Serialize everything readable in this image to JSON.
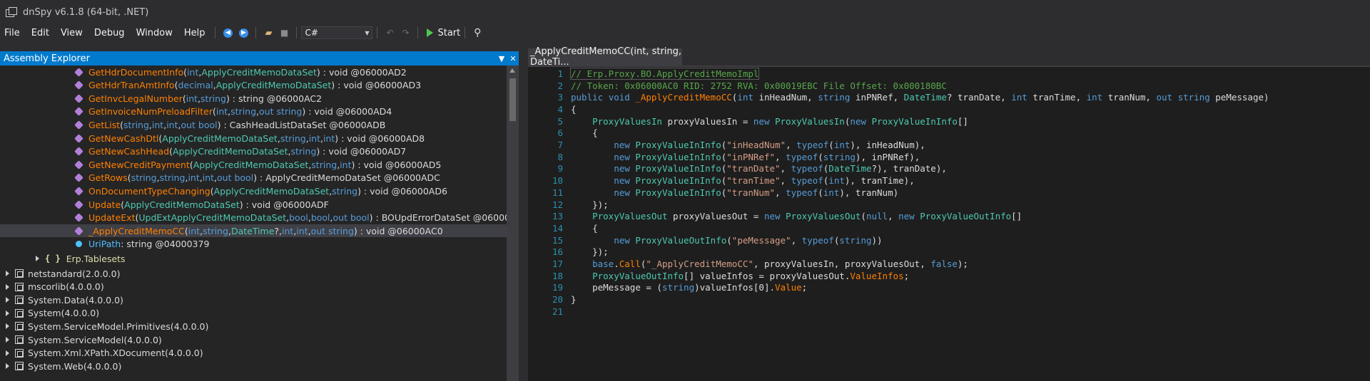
{
  "window": {
    "title": "dnSpy v6.1.8 (64-bit, .NET)"
  },
  "menu": [
    "File",
    "Edit",
    "View",
    "Debug",
    "Window",
    "Help"
  ],
  "toolbar": {
    "language": "C#",
    "start_label": "Start"
  },
  "explorer": {
    "title": "Assembly Explorer",
    "rows": [
      {
        "kind": "method",
        "name": "GetHdrDocumentInfo",
        "params": [
          [
            "int",
            "kw"
          ],
          [
            ", ",
            "plain"
          ],
          [
            "ApplyCreditMemoDataSet",
            "type"
          ]
        ],
        "ret": ") : void @06000AD2"
      },
      {
        "kind": "method",
        "name": "GetHdrTranAmtInfo",
        "params": [
          [
            "decimal",
            "kw"
          ],
          [
            ", ",
            "plain"
          ],
          [
            "ApplyCreditMemoDataSet",
            "type"
          ]
        ],
        "ret": ") : void @06000AD3"
      },
      {
        "kind": "method",
        "name": "GetInvcLegalNumber",
        "params": [
          [
            "int",
            "kw"
          ],
          [
            ", ",
            "plain"
          ],
          [
            "string",
            "kw"
          ]
        ],
        "ret": ") : string @06000AC2"
      },
      {
        "kind": "method",
        "name": "GetInvoiceNumPreloadFilter",
        "params": [
          [
            "int",
            "kw"
          ],
          [
            ", ",
            "plain"
          ],
          [
            "string",
            "kw"
          ],
          [
            ", ",
            "plain"
          ],
          [
            "out string",
            "kw"
          ]
        ],
        "ret": ") : void @06000AD4"
      },
      {
        "kind": "method",
        "name": "GetList",
        "params": [
          [
            "string",
            "kw"
          ],
          [
            ", ",
            "plain"
          ],
          [
            "int",
            "kw"
          ],
          [
            ", ",
            "plain"
          ],
          [
            "int",
            "kw"
          ],
          [
            ", ",
            "plain"
          ],
          [
            "out bool",
            "kw"
          ]
        ],
        "ret": ") : CashHeadListDataSet @06000ADB"
      },
      {
        "kind": "method",
        "name": "GetNewCashDtl",
        "params": [
          [
            "ApplyCreditMemoDataSet",
            "type"
          ],
          [
            ", ",
            "plain"
          ],
          [
            "string",
            "kw"
          ],
          [
            ", ",
            "plain"
          ],
          [
            "int",
            "kw"
          ],
          [
            ", ",
            "plain"
          ],
          [
            "int",
            "kw"
          ]
        ],
        "ret": ") : void @06000AD8"
      },
      {
        "kind": "method",
        "name": "GetNewCashHead",
        "params": [
          [
            "ApplyCreditMemoDataSet",
            "type"
          ],
          [
            ", ",
            "plain"
          ],
          [
            "string",
            "kw"
          ]
        ],
        "ret": ") : void @06000AD7"
      },
      {
        "kind": "method",
        "name": "GetNewCreditPayment",
        "params": [
          [
            "ApplyCreditMemoDataSet",
            "type"
          ],
          [
            ", ",
            "plain"
          ],
          [
            "string",
            "kw"
          ],
          [
            ", ",
            "plain"
          ],
          [
            "int",
            "kw"
          ]
        ],
        "ret": ") : void @06000AD5"
      },
      {
        "kind": "method",
        "name": "GetRows",
        "params": [
          [
            "string",
            "kw"
          ],
          [
            ", ",
            "plain"
          ],
          [
            "string",
            "kw"
          ],
          [
            ", ",
            "plain"
          ],
          [
            "int",
            "kw"
          ],
          [
            ", ",
            "plain"
          ],
          [
            "int",
            "kw"
          ],
          [
            ", ",
            "plain"
          ],
          [
            "out bool",
            "kw"
          ]
        ],
        "ret": ") : ApplyCreditMemoDataSet @06000ADC"
      },
      {
        "kind": "method",
        "name": "OnDocumentTypeChanging",
        "params": [
          [
            "ApplyCreditMemoDataSet",
            "type"
          ],
          [
            ", ",
            "plain"
          ],
          [
            "string",
            "kw"
          ]
        ],
        "ret": ") : void @06000AD6"
      },
      {
        "kind": "method",
        "name": "Update",
        "params": [
          [
            "ApplyCreditMemoDataSet",
            "type"
          ]
        ],
        "ret": ") : void @06000ADF"
      },
      {
        "kind": "method",
        "name": "UpdateExt",
        "params": [
          [
            "UpdExtApplyCreditMemoDataSet",
            "type"
          ],
          [
            ", ",
            "plain"
          ],
          [
            "bool",
            "kw"
          ],
          [
            ", ",
            "plain"
          ],
          [
            "bool",
            "kw"
          ],
          [
            ", ",
            "plain"
          ],
          [
            "out bool",
            "kw"
          ]
        ],
        "ret": ") : BOUpdErrorDataSet @06000A"
      },
      {
        "kind": "method",
        "name": "_ApplyCreditMemoCC",
        "selected": true,
        "params": [
          [
            "int",
            "kw"
          ],
          [
            ", ",
            "plain"
          ],
          [
            "string",
            "kw"
          ],
          [
            ", ",
            "plain"
          ],
          [
            "DateTime",
            "date"
          ],
          [
            "?, ",
            "plain"
          ],
          [
            "int",
            "kw"
          ],
          [
            ", ",
            "plain"
          ],
          [
            "int",
            "kw"
          ],
          [
            ", ",
            "plain"
          ],
          [
            "out string",
            "kw"
          ]
        ],
        "ret": ") : void @06000AC0"
      },
      {
        "kind": "field",
        "name": "UriPath",
        "ret": " : string @04000379"
      }
    ],
    "namespace": "Erp.Tablesets",
    "assemblies": [
      {
        "name": "netstandard",
        "version": "(2.0.0.0)"
      },
      {
        "name": "mscorlib",
        "version": "(4.0.0.0)"
      },
      {
        "name": "System.Data",
        "version": "(4.0.0.0)"
      },
      {
        "name": "System",
        "version": "(4.0.0.0)"
      },
      {
        "name": "System.ServiceModel.Primitives",
        "version": "(4.0.0.0)"
      },
      {
        "name": "System.ServiceModel",
        "version": "(4.0.0.0)"
      },
      {
        "name": "System.Xml.XPath.XDocument",
        "version": "(4.0.0.0)"
      },
      {
        "name": "System.Web",
        "version": "(4.0.0.0)"
      }
    ]
  },
  "editor": {
    "tab_label": "_ApplyCreditMemoCC(int, string, DateTi...",
    "lines": [
      [
        [
          "// Erp.Proxy.BO.ApplyCreditMemoImpl",
          "comment"
        ]
      ],
      [
        [
          "// Token: 0x06000AC0 RID: 2752 RVA: 0x00019EBC File Offset: 0x000180BC",
          "comment"
        ]
      ],
      [
        [
          "public ",
          "kw"
        ],
        [
          "void ",
          "kw"
        ],
        [
          "_ApplyCreditMemoCC",
          "method"
        ],
        [
          "(",
          "plain"
        ],
        [
          "int ",
          "kw"
        ],
        [
          "inHeadNum",
          "param"
        ],
        [
          ", ",
          "plain"
        ],
        [
          "string ",
          "kw"
        ],
        [
          "inPNRef",
          "param"
        ],
        [
          ", ",
          "plain"
        ],
        [
          "DateTime",
          "type"
        ],
        [
          "? ",
          "plain"
        ],
        [
          "tranDate",
          "param"
        ],
        [
          ", ",
          "plain"
        ],
        [
          "int ",
          "kw"
        ],
        [
          "tranTime",
          "param"
        ],
        [
          ", ",
          "plain"
        ],
        [
          "int ",
          "kw"
        ],
        [
          "tranNum",
          "param"
        ],
        [
          ", ",
          "plain"
        ],
        [
          "out ",
          "kw"
        ],
        [
          "string ",
          "kw"
        ],
        [
          "peMessage",
          "param"
        ],
        [
          ")",
          "plain"
        ]
      ],
      [
        [
          "{",
          "plain"
        ]
      ],
      [
        [
          "    ",
          "plain"
        ],
        [
          "ProxyValuesIn ",
          "type"
        ],
        [
          "proxyValuesIn = ",
          "plain"
        ],
        [
          "new ",
          "kw"
        ],
        [
          "ProxyValuesIn",
          "type"
        ],
        [
          "(",
          "plain"
        ],
        [
          "new ",
          "kw"
        ],
        [
          "ProxyValueInInfo",
          "type"
        ],
        [
          "[]",
          "plain"
        ]
      ],
      [
        [
          "    {",
          "plain"
        ]
      ],
      [
        [
          "        ",
          "plain"
        ],
        [
          "new ",
          "kw"
        ],
        [
          "ProxyValueInInfo",
          "type"
        ],
        [
          "(",
          "plain"
        ],
        [
          "\"inHeadNum\"",
          "str"
        ],
        [
          ", ",
          "plain"
        ],
        [
          "typeof",
          "kw"
        ],
        [
          "(",
          "plain"
        ],
        [
          "int",
          "kw"
        ],
        [
          "), ",
          "plain"
        ],
        [
          "inHeadNum",
          "param"
        ],
        [
          "),",
          "plain"
        ]
      ],
      [
        [
          "        ",
          "plain"
        ],
        [
          "new ",
          "kw"
        ],
        [
          "ProxyValueInInfo",
          "type"
        ],
        [
          "(",
          "plain"
        ],
        [
          "\"inPNRef\"",
          "str"
        ],
        [
          ", ",
          "plain"
        ],
        [
          "typeof",
          "kw"
        ],
        [
          "(",
          "plain"
        ],
        [
          "string",
          "kw"
        ],
        [
          "), ",
          "plain"
        ],
        [
          "inPNRef",
          "param"
        ],
        [
          "),",
          "plain"
        ]
      ],
      [
        [
          "        ",
          "plain"
        ],
        [
          "new ",
          "kw"
        ],
        [
          "ProxyValueInInfo",
          "type"
        ],
        [
          "(",
          "plain"
        ],
        [
          "\"tranDate\"",
          "str"
        ],
        [
          ", ",
          "plain"
        ],
        [
          "typeof",
          "kw"
        ],
        [
          "(",
          "plain"
        ],
        [
          "DateTime",
          "type"
        ],
        [
          "?), ",
          "plain"
        ],
        [
          "tranDate",
          "param"
        ],
        [
          "),",
          "plain"
        ]
      ],
      [
        [
          "        ",
          "plain"
        ],
        [
          "new ",
          "kw"
        ],
        [
          "ProxyValueInInfo",
          "type"
        ],
        [
          "(",
          "plain"
        ],
        [
          "\"tranTime\"",
          "str"
        ],
        [
          ", ",
          "plain"
        ],
        [
          "typeof",
          "kw"
        ],
        [
          "(",
          "plain"
        ],
        [
          "int",
          "kw"
        ],
        [
          "), ",
          "plain"
        ],
        [
          "tranTime",
          "param"
        ],
        [
          "),",
          "plain"
        ]
      ],
      [
        [
          "        ",
          "plain"
        ],
        [
          "new ",
          "kw"
        ],
        [
          "ProxyValueInInfo",
          "type"
        ],
        [
          "(",
          "plain"
        ],
        [
          "\"tranNum\"",
          "str"
        ],
        [
          ", ",
          "plain"
        ],
        [
          "typeof",
          "kw"
        ],
        [
          "(",
          "plain"
        ],
        [
          "int",
          "kw"
        ],
        [
          "), ",
          "plain"
        ],
        [
          "tranNum",
          "param"
        ],
        [
          ")",
          "plain"
        ]
      ],
      [
        [
          "    });",
          "plain"
        ]
      ],
      [
        [
          "    ",
          "plain"
        ],
        [
          "ProxyValuesOut ",
          "type"
        ],
        [
          "proxyValuesOut = ",
          "plain"
        ],
        [
          "new ",
          "kw"
        ],
        [
          "ProxyValuesOut",
          "type"
        ],
        [
          "(",
          "plain"
        ],
        [
          "null",
          "kw"
        ],
        [
          ", ",
          "plain"
        ],
        [
          "new ",
          "kw"
        ],
        [
          "ProxyValueOutInfo",
          "type"
        ],
        [
          "[]",
          "plain"
        ]
      ],
      [
        [
          "    {",
          "plain"
        ]
      ],
      [
        [
          "        ",
          "plain"
        ],
        [
          "new ",
          "kw"
        ],
        [
          "ProxyValueOutInfo",
          "type"
        ],
        [
          "(",
          "plain"
        ],
        [
          "\"peMessage\"",
          "str"
        ],
        [
          ", ",
          "plain"
        ],
        [
          "typeof",
          "kw"
        ],
        [
          "(",
          "plain"
        ],
        [
          "string",
          "kw"
        ],
        [
          "))",
          "plain"
        ]
      ],
      [
        [
          "    });",
          "plain"
        ]
      ],
      [
        [
          "    ",
          "plain"
        ],
        [
          "base",
          "kw"
        ],
        [
          ".",
          "plain"
        ],
        [
          "Call",
          "method"
        ],
        [
          "(",
          "plain"
        ],
        [
          "\"_ApplyCreditMemoCC\"",
          "str"
        ],
        [
          ", proxyValuesIn, proxyValuesOut, ",
          "plain"
        ],
        [
          "false",
          "kw"
        ],
        [
          ");",
          "plain"
        ]
      ],
      [
        [
          "    ",
          "plain"
        ],
        [
          "ProxyValueOutInfo",
          "type"
        ],
        [
          "[] valueInfos = proxyValuesOut.",
          "plain"
        ],
        [
          "ValueInfos",
          "prop"
        ],
        [
          ";",
          "plain"
        ]
      ],
      [
        [
          "    ",
          "plain"
        ],
        [
          "peMessage",
          "param"
        ],
        [
          " = (",
          "plain"
        ],
        [
          "string",
          "kw"
        ],
        [
          ")valueInfos[0].",
          "plain"
        ],
        [
          "Value",
          "prop"
        ],
        [
          ";",
          "plain"
        ]
      ],
      [
        [
          "}",
          "plain"
        ]
      ],
      [
        [
          "",
          "plain"
        ]
      ]
    ]
  },
  "colors": {
    "accent": "#007acc",
    "method": "#ff8000",
    "type": "#4ec9b0",
    "keyword": "#569cd6",
    "string": "#d69d85",
    "comment": "#57a64a"
  }
}
